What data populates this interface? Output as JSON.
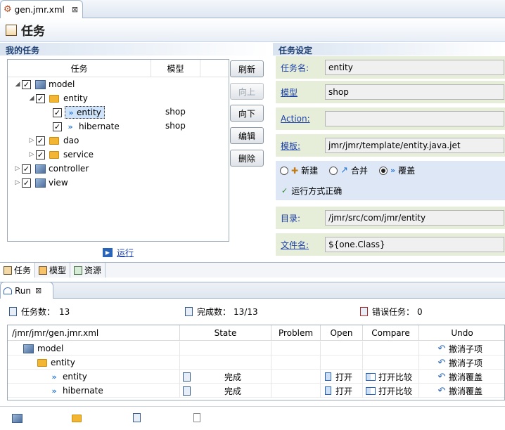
{
  "editor_tab": {
    "label": "gen.jmr.xml"
  },
  "form": {
    "title": "任务"
  },
  "my_tasks": {
    "title": "我的任务",
    "columns": [
      "任务",
      "模型"
    ],
    "rows": [
      {
        "label": "model",
        "model": ""
      },
      {
        "label": "entity",
        "model": ""
      },
      {
        "label": "entity",
        "model": "shop"
      },
      {
        "label": "hibernate",
        "model": "shop"
      },
      {
        "label": "dao",
        "model": ""
      },
      {
        "label": "service",
        "model": ""
      },
      {
        "label": "controller",
        "model": ""
      },
      {
        "label": "view",
        "model": ""
      }
    ],
    "buttons": {
      "refresh": "刷新",
      "up": "向上",
      "down": "向下",
      "edit": "编辑",
      "delete": "删除"
    },
    "run_link": "运行"
  },
  "settings": {
    "title": "任务设定",
    "task_name_label": "任务名:",
    "task_name_value": "entity",
    "model_label": "模型",
    "model_value": "shop",
    "action_label": "Action:",
    "action_value": "",
    "template_label": "模板:",
    "template_value": "jmr/jmr/template/entity.java.jet",
    "mode_new": "新建",
    "mode_merge": "合并",
    "mode_overwrite": "覆盖",
    "run_status": "运行方式正确",
    "dir_label": "目录:",
    "dir_value": "/jmr/src/com/jmr/entity",
    "file_label": "文件名:",
    "file_value": "${one.Class}"
  },
  "bottom_tabs": [
    "任务",
    "模型",
    "资源"
  ],
  "run_view": {
    "tab_label": "Run",
    "task_count_label": "任务数：",
    "task_count": "13",
    "done_label": "完成数：",
    "done_count": "13/13",
    "error_label": "错误任务：",
    "error_count": "0",
    "columns": [
      "/jmr/jmr/gen.jmr.xml",
      "State",
      "Problem",
      "Open",
      "Compare",
      "Undo"
    ],
    "rows": [
      {
        "name": "model",
        "state": "",
        "open": "",
        "compare": "",
        "undo": "撤消子项"
      },
      {
        "name": "entity",
        "state": "",
        "open": "",
        "compare": "",
        "undo": "撤消子项"
      },
      {
        "name": "entity",
        "state": "完成",
        "open": "打开",
        "compare": "打开比较",
        "undo": "撤消覆盖"
      },
      {
        "name": "hibernate",
        "state": "完成",
        "open": "打开",
        "compare": "打开比较",
        "undo": "撤消覆盖"
      }
    ]
  },
  "colors": {
    "accent": "#1d3f72",
    "field_bg": "#e6edd8",
    "radio_bg": "#dde7f6"
  }
}
